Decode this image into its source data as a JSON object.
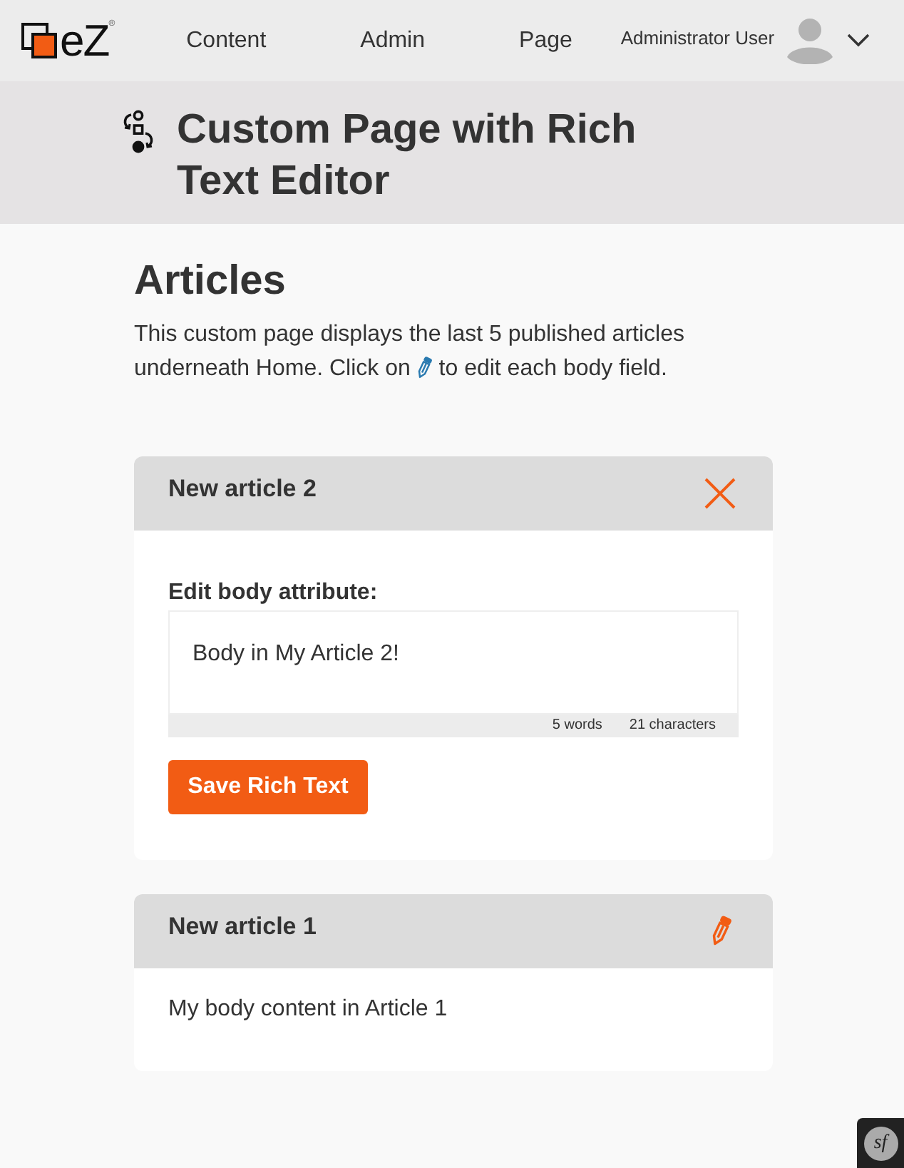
{
  "nav": {
    "logo": {
      "text": "eZ",
      "mark": "®"
    },
    "items": [
      {
        "label": "Content"
      },
      {
        "label": "Admin"
      },
      {
        "label": "Page"
      }
    ],
    "user": {
      "name": "Administrator User"
    }
  },
  "page_header": {
    "title": "Custom Page with Rich Text Editor"
  },
  "intro": {
    "heading": "Articles",
    "text_before": "This custom page displays the last 5 published articles underneath Home. Click on",
    "text_after": "to edit each body field."
  },
  "articles": [
    {
      "title": "New article 2",
      "editing": true,
      "editor": {
        "label": "Edit body attribute:",
        "value": "Body in My Article 2!",
        "word_count": "5 words",
        "character_count": "21 characters",
        "save_button": "Save Rich Text"
      }
    },
    {
      "title": "New article 1",
      "editing": false,
      "body": "My body content in Article 1"
    }
  ],
  "debug_toolbar": {
    "label": "sf"
  }
}
